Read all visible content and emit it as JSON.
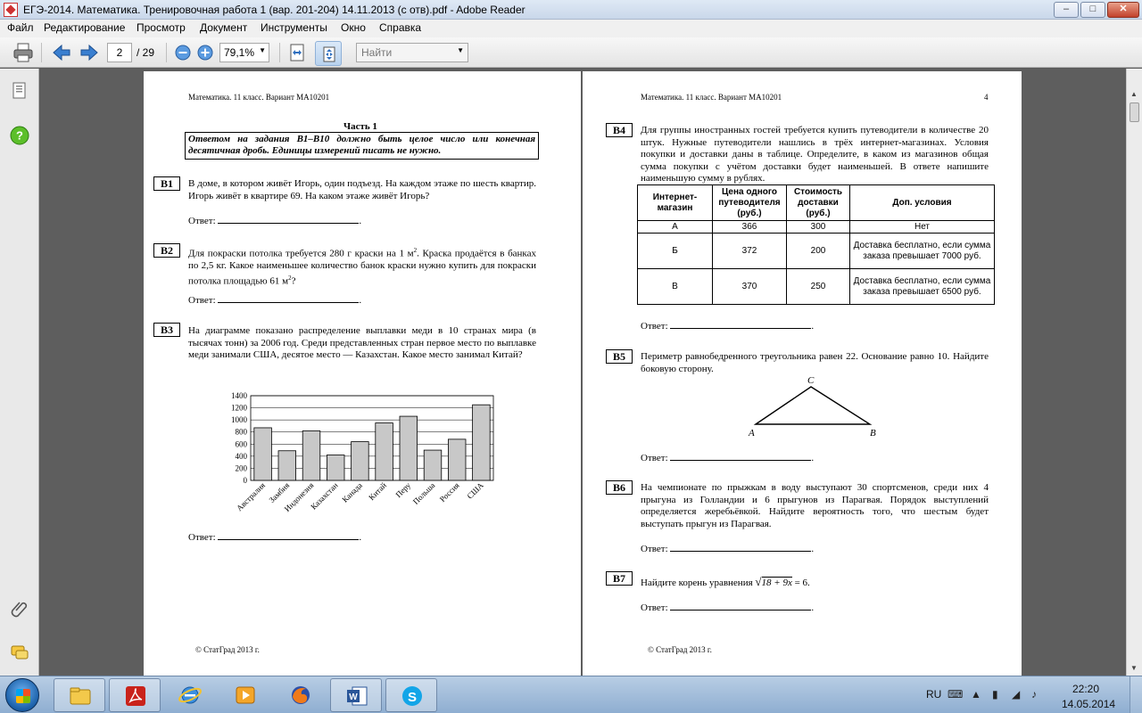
{
  "window": {
    "title": "ЕГЭ-2014. Математика. Тренировочная работа 1 (вар. 201-204) 14.11.2013 (с отв).pdf - Adobe Reader",
    "min": "–",
    "max": "□",
    "close": "✕"
  },
  "menu": [
    "Файл",
    "Редактирование",
    "Просмотр",
    "Документ",
    "Инструменты",
    "Окно",
    "Справка"
  ],
  "toolbar": {
    "page_current": "2",
    "page_total": "/ 29",
    "zoom": "79,1%",
    "find_placeholder": "Найти"
  },
  "left_page": {
    "header": "Математика. 11 класс. Вариант МА10201",
    "part_title": "Часть 1",
    "instruction": "Ответом на задания В1–В10 должно быть целое число или конечная десятичная дробь. Единицы измерений писать не нужно.",
    "answer_label": "Ответ:",
    "footer": "© СтатГрад 2013 г.",
    "tasks": [
      {
        "label": "B1",
        "text": "В доме, в котором живёт Игорь, один подъезд. На каждом этаже по шесть квартир. Игорь живёт в квартире 69. На каком этаже живёт Игорь?"
      },
      {
        "label": "B2",
        "text_a": "Для покраски потолка требуется 280 г краски на 1 м",
        "text_b": ". Краска продаётся в банках по 2,5 кг. Какое наименьшее количество банок краски нужно купить для покраски потолка площадью 61 м",
        "text_c": "?",
        "sup": "2"
      },
      {
        "label": "B3",
        "text": "На диаграмме показано распределение выплавки меди в 10 странах мира (в тысячах тонн) за 2006 год. Среди представленных стран первое место по выплавке меди занимали США, десятое место — Казахстан. Какое место занимал Китай?"
      }
    ]
  },
  "right_page": {
    "header": "Математика. 11 класс. Вариант МА10201",
    "page_number": "4",
    "answer_label": "Ответ:",
    "footer": "© СтатГрад 2013 г.",
    "tasks": [
      {
        "label": "B4",
        "text": "Для группы иностранных гостей требуется купить путеводители в количестве 20 штук. Нужные путеводители нашлись в трёх интернет-магазинах. Условия покупки и доставки даны в таблице. Определите, в каком из магазинов общая сумма покупки с учётом доставки будет наименьшей. В ответе напишите наименьшую сумму в рублях."
      },
      {
        "label": "B5",
        "text": "Периметр равнобедренного треугольника равен 22. Основание равно 10. Найдите боковую сторону."
      },
      {
        "label": "B6",
        "text": "На чемпионате по прыжкам в воду выступают 30 спортсменов, среди них 4 прыгуна из Голландии и 6 прыгунов из Парагвая. Порядок выступлений определяется жеребьёвкой. Найдите вероятность того, что шестым будет выступать прыгун из Парагвая."
      },
      {
        "label": "B7",
        "text_a": "Найдите корень уравнения ",
        "radicand": "18 + 9x",
        "text_b": " = 6."
      }
    ],
    "table": {
      "headers": [
        "Интернет-магазин",
        "Цена одного путеводителя (руб.)",
        "Стоимость доставки (руб.)",
        "Доп. условия"
      ],
      "rows": [
        [
          "А",
          "366",
          "300",
          "Нет"
        ],
        [
          "Б",
          "372",
          "200",
          "Доставка бесплатно, если сумма заказа превышает 7000 руб."
        ],
        [
          "В",
          "370",
          "250",
          "Доставка бесплатно, если сумма заказа превышает 6500 руб."
        ]
      ]
    },
    "triangle": {
      "A": "A",
      "B": "B",
      "C": "C"
    }
  },
  "chart_data": {
    "type": "bar",
    "categories": [
      "Австралия",
      "Замбия",
      "Индонезия",
      "Казахстан",
      "Канада",
      "Китай",
      "Перу",
      "Польша",
      "Россия",
      "США"
    ],
    "values": [
      870,
      490,
      820,
      420,
      640,
      950,
      1060,
      500,
      680,
      1250
    ],
    "yticks": [
      "0",
      "200",
      "400",
      "600",
      "800",
      "1000",
      "1200",
      "1400"
    ],
    "ylim": [
      0,
      1400
    ],
    "grid": true,
    "bar_color": "#c8c8c8"
  },
  "taskbar": {
    "apps": [
      "explorer-icon",
      "adobe-reader-icon",
      "internet-explorer-icon",
      "media-player-icon",
      "firefox-icon",
      "word-icon",
      "skype-icon"
    ],
    "lang": "RU",
    "time": "22:20",
    "date": "14.05.2014"
  }
}
